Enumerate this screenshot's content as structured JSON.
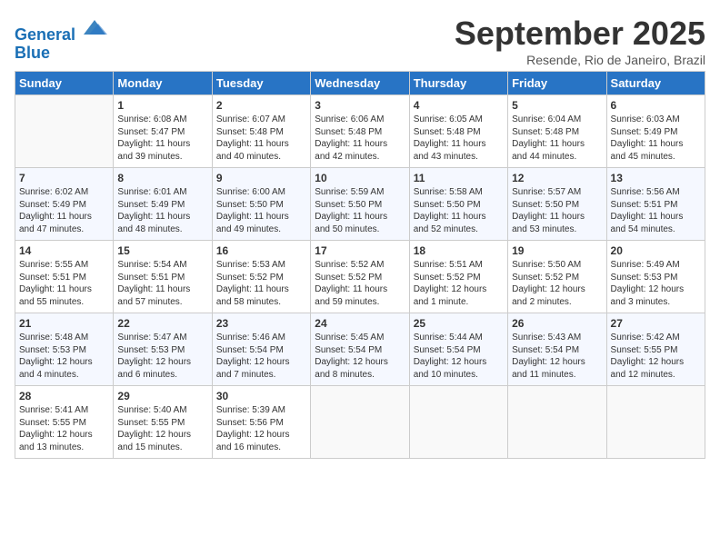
{
  "header": {
    "logo_line1": "General",
    "logo_line2": "Blue",
    "month_title": "September 2025",
    "location": "Resende, Rio de Janeiro, Brazil"
  },
  "days_of_week": [
    "Sunday",
    "Monday",
    "Tuesday",
    "Wednesday",
    "Thursday",
    "Friday",
    "Saturday"
  ],
  "weeks": [
    [
      {
        "day": "",
        "info": ""
      },
      {
        "day": "1",
        "info": "Sunrise: 6:08 AM\nSunset: 5:47 PM\nDaylight: 11 hours\nand 39 minutes."
      },
      {
        "day": "2",
        "info": "Sunrise: 6:07 AM\nSunset: 5:48 PM\nDaylight: 11 hours\nand 40 minutes."
      },
      {
        "day": "3",
        "info": "Sunrise: 6:06 AM\nSunset: 5:48 PM\nDaylight: 11 hours\nand 42 minutes."
      },
      {
        "day": "4",
        "info": "Sunrise: 6:05 AM\nSunset: 5:48 PM\nDaylight: 11 hours\nand 43 minutes."
      },
      {
        "day": "5",
        "info": "Sunrise: 6:04 AM\nSunset: 5:48 PM\nDaylight: 11 hours\nand 44 minutes."
      },
      {
        "day": "6",
        "info": "Sunrise: 6:03 AM\nSunset: 5:49 PM\nDaylight: 11 hours\nand 45 minutes."
      }
    ],
    [
      {
        "day": "7",
        "info": "Sunrise: 6:02 AM\nSunset: 5:49 PM\nDaylight: 11 hours\nand 47 minutes."
      },
      {
        "day": "8",
        "info": "Sunrise: 6:01 AM\nSunset: 5:49 PM\nDaylight: 11 hours\nand 48 minutes."
      },
      {
        "day": "9",
        "info": "Sunrise: 6:00 AM\nSunset: 5:50 PM\nDaylight: 11 hours\nand 49 minutes."
      },
      {
        "day": "10",
        "info": "Sunrise: 5:59 AM\nSunset: 5:50 PM\nDaylight: 11 hours\nand 50 minutes."
      },
      {
        "day": "11",
        "info": "Sunrise: 5:58 AM\nSunset: 5:50 PM\nDaylight: 11 hours\nand 52 minutes."
      },
      {
        "day": "12",
        "info": "Sunrise: 5:57 AM\nSunset: 5:50 PM\nDaylight: 11 hours\nand 53 minutes."
      },
      {
        "day": "13",
        "info": "Sunrise: 5:56 AM\nSunset: 5:51 PM\nDaylight: 11 hours\nand 54 minutes."
      }
    ],
    [
      {
        "day": "14",
        "info": "Sunrise: 5:55 AM\nSunset: 5:51 PM\nDaylight: 11 hours\nand 55 minutes."
      },
      {
        "day": "15",
        "info": "Sunrise: 5:54 AM\nSunset: 5:51 PM\nDaylight: 11 hours\nand 57 minutes."
      },
      {
        "day": "16",
        "info": "Sunrise: 5:53 AM\nSunset: 5:52 PM\nDaylight: 11 hours\nand 58 minutes."
      },
      {
        "day": "17",
        "info": "Sunrise: 5:52 AM\nSunset: 5:52 PM\nDaylight: 11 hours\nand 59 minutes."
      },
      {
        "day": "18",
        "info": "Sunrise: 5:51 AM\nSunset: 5:52 PM\nDaylight: 12 hours\nand 1 minute."
      },
      {
        "day": "19",
        "info": "Sunrise: 5:50 AM\nSunset: 5:52 PM\nDaylight: 12 hours\nand 2 minutes."
      },
      {
        "day": "20",
        "info": "Sunrise: 5:49 AM\nSunset: 5:53 PM\nDaylight: 12 hours\nand 3 minutes."
      }
    ],
    [
      {
        "day": "21",
        "info": "Sunrise: 5:48 AM\nSunset: 5:53 PM\nDaylight: 12 hours\nand 4 minutes."
      },
      {
        "day": "22",
        "info": "Sunrise: 5:47 AM\nSunset: 5:53 PM\nDaylight: 12 hours\nand 6 minutes."
      },
      {
        "day": "23",
        "info": "Sunrise: 5:46 AM\nSunset: 5:54 PM\nDaylight: 12 hours\nand 7 minutes."
      },
      {
        "day": "24",
        "info": "Sunrise: 5:45 AM\nSunset: 5:54 PM\nDaylight: 12 hours\nand 8 minutes."
      },
      {
        "day": "25",
        "info": "Sunrise: 5:44 AM\nSunset: 5:54 PM\nDaylight: 12 hours\nand 10 minutes."
      },
      {
        "day": "26",
        "info": "Sunrise: 5:43 AM\nSunset: 5:54 PM\nDaylight: 12 hours\nand 11 minutes."
      },
      {
        "day": "27",
        "info": "Sunrise: 5:42 AM\nSunset: 5:55 PM\nDaylight: 12 hours\nand 12 minutes."
      }
    ],
    [
      {
        "day": "28",
        "info": "Sunrise: 5:41 AM\nSunset: 5:55 PM\nDaylight: 12 hours\nand 13 minutes."
      },
      {
        "day": "29",
        "info": "Sunrise: 5:40 AM\nSunset: 5:55 PM\nDaylight: 12 hours\nand 15 minutes."
      },
      {
        "day": "30",
        "info": "Sunrise: 5:39 AM\nSunset: 5:56 PM\nDaylight: 12 hours\nand 16 minutes."
      },
      {
        "day": "",
        "info": ""
      },
      {
        "day": "",
        "info": ""
      },
      {
        "day": "",
        "info": ""
      },
      {
        "day": "",
        "info": ""
      }
    ]
  ]
}
